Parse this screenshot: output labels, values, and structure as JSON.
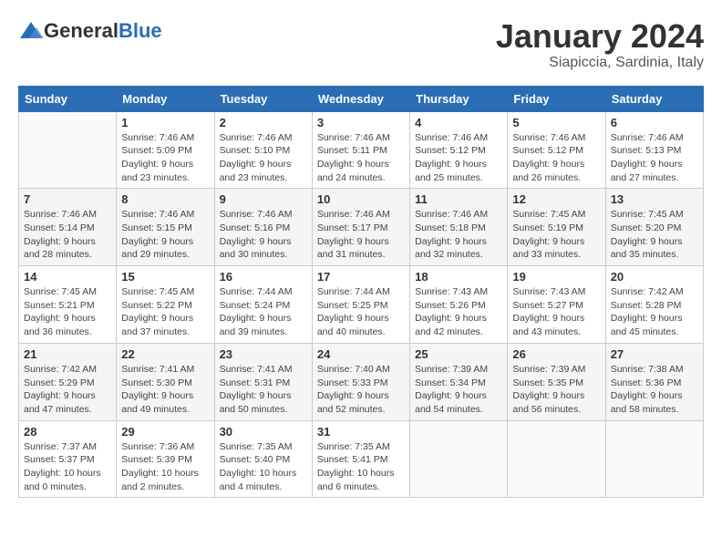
{
  "header": {
    "logo_general": "General",
    "logo_blue": "Blue",
    "month": "January 2024",
    "location": "Siapiccia, Sardinia, Italy"
  },
  "weekdays": [
    "Sunday",
    "Monday",
    "Tuesday",
    "Wednesday",
    "Thursday",
    "Friday",
    "Saturday"
  ],
  "weeks": [
    [
      {
        "day": "",
        "sunrise": "",
        "sunset": "",
        "daylight": ""
      },
      {
        "day": "1",
        "sunrise": "Sunrise: 7:46 AM",
        "sunset": "Sunset: 5:09 PM",
        "daylight": "Daylight: 9 hours and 23 minutes."
      },
      {
        "day": "2",
        "sunrise": "Sunrise: 7:46 AM",
        "sunset": "Sunset: 5:10 PM",
        "daylight": "Daylight: 9 hours and 23 minutes."
      },
      {
        "day": "3",
        "sunrise": "Sunrise: 7:46 AM",
        "sunset": "Sunset: 5:11 PM",
        "daylight": "Daylight: 9 hours and 24 minutes."
      },
      {
        "day": "4",
        "sunrise": "Sunrise: 7:46 AM",
        "sunset": "Sunset: 5:12 PM",
        "daylight": "Daylight: 9 hours and 25 minutes."
      },
      {
        "day": "5",
        "sunrise": "Sunrise: 7:46 AM",
        "sunset": "Sunset: 5:12 PM",
        "daylight": "Daylight: 9 hours and 26 minutes."
      },
      {
        "day": "6",
        "sunrise": "Sunrise: 7:46 AM",
        "sunset": "Sunset: 5:13 PM",
        "daylight": "Daylight: 9 hours and 27 minutes."
      }
    ],
    [
      {
        "day": "7",
        "sunrise": "Sunrise: 7:46 AM",
        "sunset": "Sunset: 5:14 PM",
        "daylight": "Daylight: 9 hours and 28 minutes."
      },
      {
        "day": "8",
        "sunrise": "Sunrise: 7:46 AM",
        "sunset": "Sunset: 5:15 PM",
        "daylight": "Daylight: 9 hours and 29 minutes."
      },
      {
        "day": "9",
        "sunrise": "Sunrise: 7:46 AM",
        "sunset": "Sunset: 5:16 PM",
        "daylight": "Daylight: 9 hours and 30 minutes."
      },
      {
        "day": "10",
        "sunrise": "Sunrise: 7:46 AM",
        "sunset": "Sunset: 5:17 PM",
        "daylight": "Daylight: 9 hours and 31 minutes."
      },
      {
        "day": "11",
        "sunrise": "Sunrise: 7:46 AM",
        "sunset": "Sunset: 5:18 PM",
        "daylight": "Daylight: 9 hours and 32 minutes."
      },
      {
        "day": "12",
        "sunrise": "Sunrise: 7:45 AM",
        "sunset": "Sunset: 5:19 PM",
        "daylight": "Daylight: 9 hours and 33 minutes."
      },
      {
        "day": "13",
        "sunrise": "Sunrise: 7:45 AM",
        "sunset": "Sunset: 5:20 PM",
        "daylight": "Daylight: 9 hours and 35 minutes."
      }
    ],
    [
      {
        "day": "14",
        "sunrise": "Sunrise: 7:45 AM",
        "sunset": "Sunset: 5:21 PM",
        "daylight": "Daylight: 9 hours and 36 minutes."
      },
      {
        "day": "15",
        "sunrise": "Sunrise: 7:45 AM",
        "sunset": "Sunset: 5:22 PM",
        "daylight": "Daylight: 9 hours and 37 minutes."
      },
      {
        "day": "16",
        "sunrise": "Sunrise: 7:44 AM",
        "sunset": "Sunset: 5:24 PM",
        "daylight": "Daylight: 9 hours and 39 minutes."
      },
      {
        "day": "17",
        "sunrise": "Sunrise: 7:44 AM",
        "sunset": "Sunset: 5:25 PM",
        "daylight": "Daylight: 9 hours and 40 minutes."
      },
      {
        "day": "18",
        "sunrise": "Sunrise: 7:43 AM",
        "sunset": "Sunset: 5:26 PM",
        "daylight": "Daylight: 9 hours and 42 minutes."
      },
      {
        "day": "19",
        "sunrise": "Sunrise: 7:43 AM",
        "sunset": "Sunset: 5:27 PM",
        "daylight": "Daylight: 9 hours and 43 minutes."
      },
      {
        "day": "20",
        "sunrise": "Sunrise: 7:42 AM",
        "sunset": "Sunset: 5:28 PM",
        "daylight": "Daylight: 9 hours and 45 minutes."
      }
    ],
    [
      {
        "day": "21",
        "sunrise": "Sunrise: 7:42 AM",
        "sunset": "Sunset: 5:29 PM",
        "daylight": "Daylight: 9 hours and 47 minutes."
      },
      {
        "day": "22",
        "sunrise": "Sunrise: 7:41 AM",
        "sunset": "Sunset: 5:30 PM",
        "daylight": "Daylight: 9 hours and 49 minutes."
      },
      {
        "day": "23",
        "sunrise": "Sunrise: 7:41 AM",
        "sunset": "Sunset: 5:31 PM",
        "daylight": "Daylight: 9 hours and 50 minutes."
      },
      {
        "day": "24",
        "sunrise": "Sunrise: 7:40 AM",
        "sunset": "Sunset: 5:33 PM",
        "daylight": "Daylight: 9 hours and 52 minutes."
      },
      {
        "day": "25",
        "sunrise": "Sunrise: 7:39 AM",
        "sunset": "Sunset: 5:34 PM",
        "daylight": "Daylight: 9 hours and 54 minutes."
      },
      {
        "day": "26",
        "sunrise": "Sunrise: 7:39 AM",
        "sunset": "Sunset: 5:35 PM",
        "daylight": "Daylight: 9 hours and 56 minutes."
      },
      {
        "day": "27",
        "sunrise": "Sunrise: 7:38 AM",
        "sunset": "Sunset: 5:36 PM",
        "daylight": "Daylight: 9 hours and 58 minutes."
      }
    ],
    [
      {
        "day": "28",
        "sunrise": "Sunrise: 7:37 AM",
        "sunset": "Sunset: 5:37 PM",
        "daylight": "Daylight: 10 hours and 0 minutes."
      },
      {
        "day": "29",
        "sunrise": "Sunrise: 7:36 AM",
        "sunset": "Sunset: 5:39 PM",
        "daylight": "Daylight: 10 hours and 2 minutes."
      },
      {
        "day": "30",
        "sunrise": "Sunrise: 7:35 AM",
        "sunset": "Sunset: 5:40 PM",
        "daylight": "Daylight: 10 hours and 4 minutes."
      },
      {
        "day": "31",
        "sunrise": "Sunrise: 7:35 AM",
        "sunset": "Sunset: 5:41 PM",
        "daylight": "Daylight: 10 hours and 6 minutes."
      },
      {
        "day": "",
        "sunrise": "",
        "sunset": "",
        "daylight": ""
      },
      {
        "day": "",
        "sunrise": "",
        "sunset": "",
        "daylight": ""
      },
      {
        "day": "",
        "sunrise": "",
        "sunset": "",
        "daylight": ""
      }
    ]
  ]
}
